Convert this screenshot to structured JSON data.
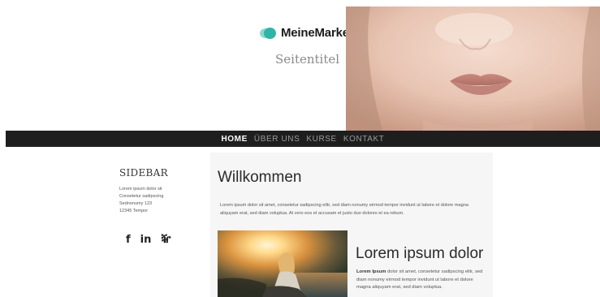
{
  "brand": {
    "name": "MeineMarke",
    "logo_icon": "bubble-logo-icon",
    "accent": "#2fb5a8"
  },
  "site_title": "Seitentitel",
  "nav": {
    "items": [
      {
        "label": "HOME",
        "active": true
      },
      {
        "label": "ÜBER UNS",
        "active": false
      },
      {
        "label": "KURSE",
        "active": false
      },
      {
        "label": "KONTAKT",
        "active": false
      }
    ],
    "background": "#1e1e1e"
  },
  "sidebar": {
    "title": "SIDEBAR",
    "address": [
      "Lorem ipsum dolor sit",
      "Consetetur sadipscing",
      "Sednonumy 123",
      "12345 Tempor"
    ],
    "socials": [
      {
        "label": "f",
        "icon": "facebook-icon"
      },
      {
        "label": "in",
        "icon": "linkedin-icon"
      },
      {
        "label": "ⶵ",
        "icon": "xing-icon"
      }
    ]
  },
  "main": {
    "title": "Willkommen",
    "intro": "Lorem ipsum dolor sit amet, consetetur sadipscing elitr, sed diam nonumy eirmod tempor invidunt ut labore et dolore magna aliquyam erat, sed diam voluptua. At vero eos et accusam et justo duo dolores et ea rebum.",
    "column_title": "Lorem ipsum dolor",
    "column_bold": "Lorem Ipsum",
    "column_text": " dolor sit amet, consetetur sadipscing elitr, sed diam nonumy eirmod tempor invidunt ut labore et dolore magna aliquyam erat, sed diam voluptua."
  }
}
